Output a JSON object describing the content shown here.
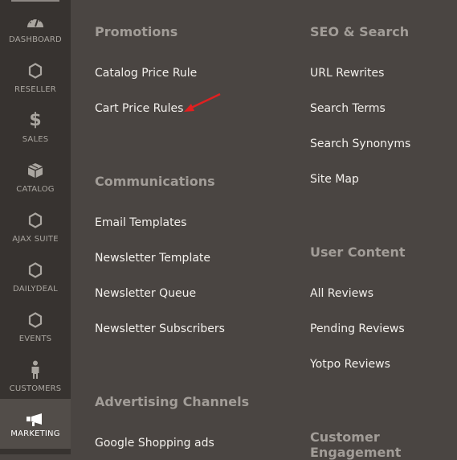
{
  "sidebar": {
    "items": [
      {
        "label": "DASHBOARD",
        "icon": "dashboard-icon"
      },
      {
        "label": "RESELLER",
        "icon": "hexagon-icon"
      },
      {
        "label": "SALES",
        "icon": "dollar-icon"
      },
      {
        "label": "CATALOG",
        "icon": "box-icon"
      },
      {
        "label": "AJAX SUITE",
        "icon": "hexagon-icon"
      },
      {
        "label": "DAILYDEAL",
        "icon": "hexagon-icon"
      },
      {
        "label": "EVENTS",
        "icon": "hexagon-icon"
      },
      {
        "label": "CUSTOMERS",
        "icon": "person-icon"
      },
      {
        "label": "MARKETING",
        "icon": "megaphone-icon",
        "active": true
      }
    ]
  },
  "submenu": {
    "promotions": {
      "title": "Promotions",
      "items": [
        "Catalog Price Rule",
        "Cart Price Rules"
      ]
    },
    "communications": {
      "title": "Communications",
      "items": [
        "Email Templates",
        "Newsletter Template",
        "Newsletter Queue",
        "Newsletter Subscribers"
      ]
    },
    "advertising": {
      "title": "Advertising Channels",
      "items": [
        "Google Shopping ads"
      ]
    },
    "seo": {
      "title": "SEO & Search",
      "items": [
        "URL Rewrites",
        "Search Terms",
        "Search Synonyms",
        "Site Map"
      ]
    },
    "user_content": {
      "title": "User Content",
      "items": [
        "All Reviews",
        "Pending Reviews",
        "Yotpo Reviews"
      ]
    },
    "customer_engagement": {
      "title": "Customer Engagement"
    }
  },
  "annotation": {
    "arrow_color": "#e02020"
  }
}
